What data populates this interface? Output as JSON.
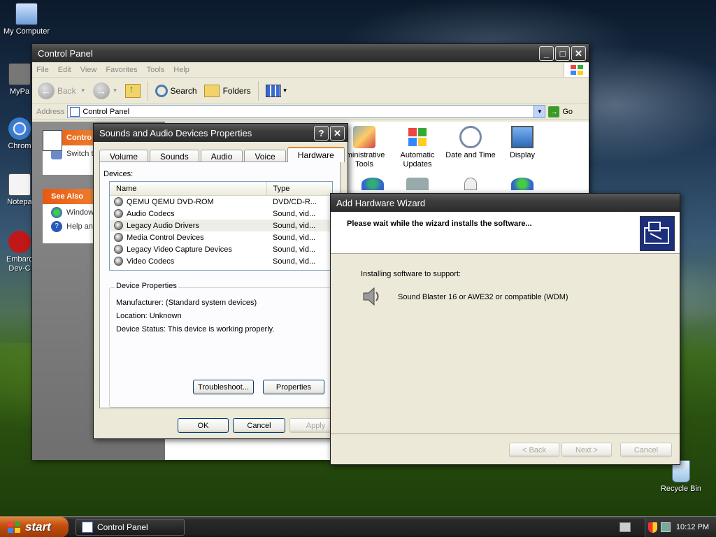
{
  "desktop": {
    "icons": [
      {
        "label": "My Computer"
      },
      {
        "label": "MyPa"
      },
      {
        "label": "Chrom"
      },
      {
        "label": "Notepa"
      },
      {
        "label": "Embarc Dev-C"
      },
      {
        "label": "Recycle Bin"
      }
    ]
  },
  "control_panel": {
    "title": "Control Panel",
    "menu": [
      "File",
      "Edit",
      "View",
      "Favorites",
      "Tools",
      "Help"
    ],
    "toolbar": {
      "back": "Back",
      "search": "Search",
      "folders": "Folders"
    },
    "address": {
      "label": "Address",
      "value": "Control Panel",
      "go": "Go"
    },
    "left_pane": {
      "control_header": "Contro",
      "switch_link": "Switch t",
      "see_also_header": "See Also",
      "see_also_items": [
        "Window",
        "Help an"
      ]
    },
    "icons": [
      {
        "label": "Administrative Tools",
        "line1": "Iministrative",
        "line2": "Tools"
      },
      {
        "label": "Automatic Updates",
        "line1": "Automatic",
        "line2": "Updates"
      },
      {
        "label": "Date and Time",
        "line1": "Date and Time",
        "line2": ""
      },
      {
        "label": "Display",
        "line1": "Display",
        "line2": ""
      }
    ]
  },
  "sounds_dialog": {
    "title": "Sounds and Audio Devices Properties",
    "help_btn": "?",
    "close_btn": "✕",
    "tabs": [
      "Volume",
      "Sounds",
      "Audio",
      "Voice",
      "Hardware"
    ],
    "active_tab": "Hardware",
    "devices_label": "Devices:",
    "columns": [
      "Name",
      "Type"
    ],
    "devices": [
      {
        "name": "QEMU QEMU DVD-ROM",
        "type": "DVD/CD-R..."
      },
      {
        "name": "Audio Codecs",
        "type": "Sound, vid..."
      },
      {
        "name": "Legacy Audio Drivers",
        "type": "Sound, vid..."
      },
      {
        "name": "Media Control Devices",
        "type": "Sound, vid..."
      },
      {
        "name": "Legacy Video Capture Devices",
        "type": "Sound, vid..."
      },
      {
        "name": "Video Codecs",
        "type": "Sound, vid..."
      }
    ],
    "properties": {
      "title": "Device Properties",
      "manufacturer": "Manufacturer: (Standard system devices)",
      "location": "Location: Unknown",
      "status": "Device Status: This device is working properly."
    },
    "buttons": {
      "troubleshoot": "Troubleshoot...",
      "properties": "Properties",
      "ok": "OK",
      "cancel": "Cancel",
      "apply": "Apply"
    }
  },
  "wizard": {
    "title": "Add Hardware Wizard",
    "heading": "Please wait while the wizard installs the software...",
    "installing_label": "Installing software to support:",
    "device_name": "Sound Blaster 16 or AWE32 or compatible (WDM)",
    "buttons": {
      "back": "< Back",
      "next": "Next >",
      "cancel": "Cancel"
    }
  },
  "taskbar": {
    "start": "start",
    "task_item": "Control Panel",
    "clock": "10:12 PM"
  }
}
